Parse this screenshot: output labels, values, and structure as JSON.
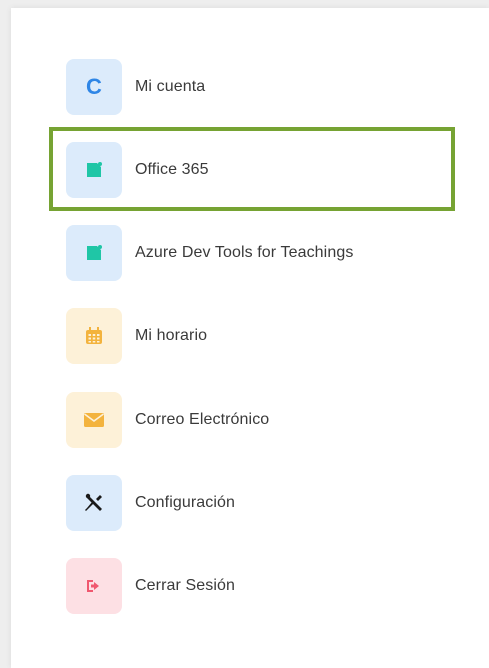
{
  "menu": {
    "items": [
      {
        "label": "Mi cuenta",
        "icon": "letter-c-icon",
        "icon_text": "C",
        "tile_color": "#dcebfb",
        "icon_color": "#2f86e6"
      },
      {
        "label": "Office 365",
        "icon": "document-icon",
        "tile_color": "#dcebfb",
        "icon_color": "#1fc6a6",
        "highlighted": true
      },
      {
        "label": "Azure Dev Tools for Teachings",
        "icon": "document-icon",
        "tile_color": "#dcebfb",
        "icon_color": "#1fc6a6"
      },
      {
        "label": "Mi horario",
        "icon": "calendar-icon",
        "tile_color": "#fdf1d8",
        "icon_color": "#f3b33d"
      },
      {
        "label": "Correo Electrónico",
        "icon": "envelope-icon",
        "tile_color": "#fdf1d8",
        "icon_color": "#f3b33d"
      },
      {
        "label": "Configuración",
        "icon": "tools-icon",
        "tile_color": "#dcebfb",
        "icon_color": "#1a1a1a"
      },
      {
        "label": "Cerrar Sesión",
        "icon": "logout-icon",
        "tile_color": "#fde0e4",
        "icon_color": "#f0586f"
      }
    ]
  },
  "highlight_color": "#76a333"
}
